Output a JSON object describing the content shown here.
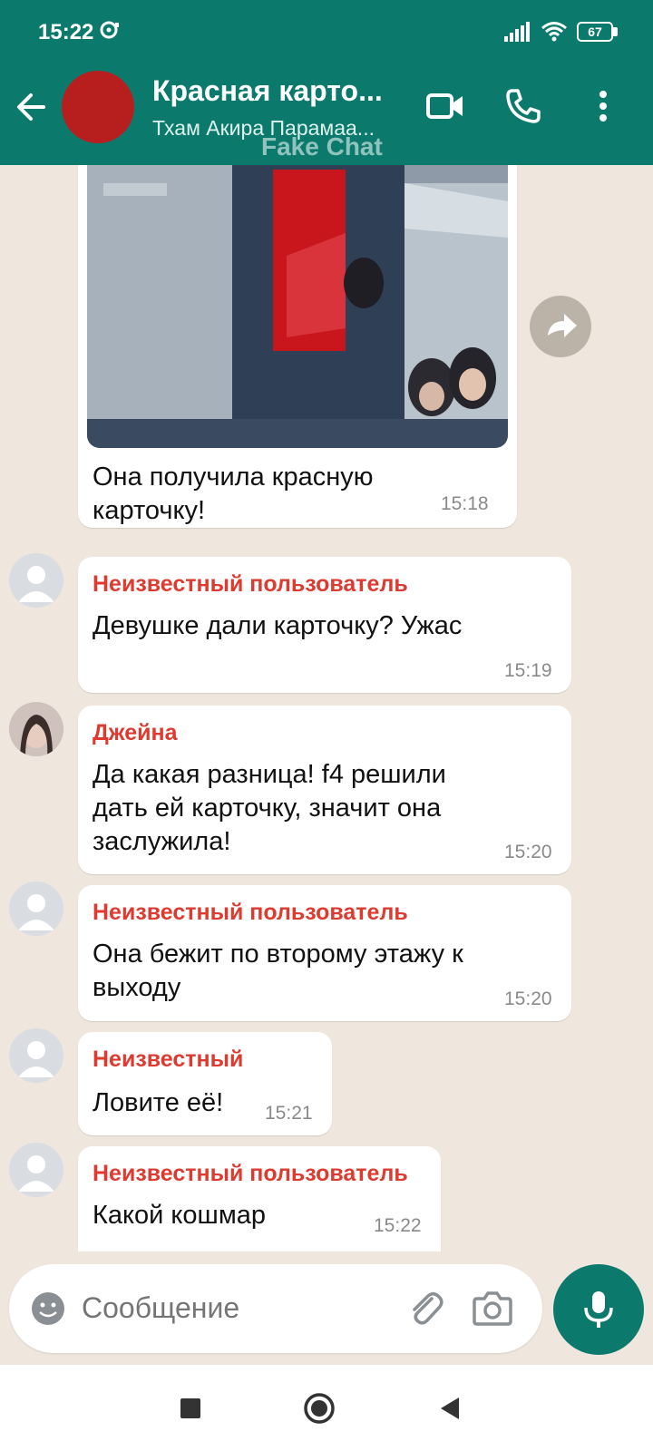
{
  "status_bar": {
    "time": "15:22",
    "battery": "67"
  },
  "header": {
    "title": "Красная карто...",
    "subtitle": "Тхам Акира Парамаа...",
    "watermark": "Fake Chat"
  },
  "messages": [
    {
      "kind": "image",
      "text": "Она получила красную карточку!",
      "time": "15:18"
    },
    {
      "sender": "Неизвестный пользователь",
      "text": "Девушке дали карточку? Ужас",
      "time": "15:19"
    },
    {
      "sender": "Джейна",
      "text": "Да какая разница! f4 решили дать ей карточку, значит она заслужила!",
      "time": "15:20"
    },
    {
      "sender": "Неизвестный пользователь",
      "text": "Она бежит по второму этажу к выходу",
      "time": "15:20"
    },
    {
      "sender": "Неизвестный",
      "text": "Ловите её!",
      "time": "15:21"
    },
    {
      "sender": "Неизвестный пользователь",
      "text": "Какой кошмар",
      "time": "15:22"
    }
  ],
  "composer": {
    "placeholder": "Сообщение"
  },
  "colors": {
    "brand": "#0b7a6d",
    "sender_name": "#de3b30",
    "chat_background": "#efe7de",
    "avatar_red": "#b71f1f"
  },
  "icons": [
    "back-arrow-icon",
    "video-call-icon",
    "phone-icon",
    "more-vert-icon",
    "forward-icon",
    "emoji-icon",
    "paperclip-icon",
    "camera-icon",
    "mic-icon",
    "nav-square-icon",
    "nav-circle-icon",
    "nav-triangle-icon"
  ]
}
